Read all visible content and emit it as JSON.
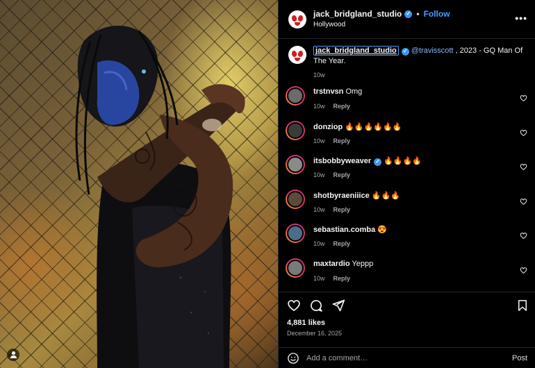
{
  "post": {
    "username": "jack_bridgland_studio",
    "follow_label": "Follow",
    "dot": "•",
    "location": "Hollywood",
    "more_label": "•••"
  },
  "caption": {
    "username": "jack_bridgland_studio",
    "mention": "@travisscott",
    "text": " , 2023 - GQ Man Of The Year.",
    "time": "10w"
  },
  "comments": [
    {
      "user": "trstnvsn",
      "text": " Omg",
      "verified": false,
      "time": "10w",
      "reply": "Reply",
      "avatar_color": "#6b6b6b"
    },
    {
      "user": "donziop",
      "text": " 🔥🔥🔥🔥🔥🔥",
      "verified": false,
      "time": "10w",
      "reply": "Reply",
      "avatar_color": "#3a3a3a"
    },
    {
      "user": "itsbobbyweaver",
      "text": " 🔥🔥🔥🔥",
      "verified": true,
      "time": "10w",
      "reply": "Reply",
      "avatar_color": "#8a8a8a"
    },
    {
      "user": "shotbyraeniiice",
      "text": " 🔥🔥🔥",
      "verified": false,
      "time": "10w",
      "reply": "Reply",
      "avatar_color": "#5c4a3a"
    },
    {
      "user": "sebastian.comba",
      "text": " 😍",
      "verified": false,
      "time": "10w",
      "reply": "Reply",
      "avatar_color": "#4a6d8a"
    },
    {
      "user": "maxtardio",
      "text": " Yeppp",
      "verified": false,
      "time": "10w",
      "reply": "Reply",
      "avatar_color": "#7a7a7a"
    }
  ],
  "stats": {
    "likes": "4,881 likes",
    "date": "December 16, 2025"
  },
  "compose": {
    "placeholder": "Add a comment…",
    "post_label": "Post"
  },
  "colors": {
    "accent": "#4a9dff",
    "verified": "#3897f0",
    "background": "#000000"
  }
}
